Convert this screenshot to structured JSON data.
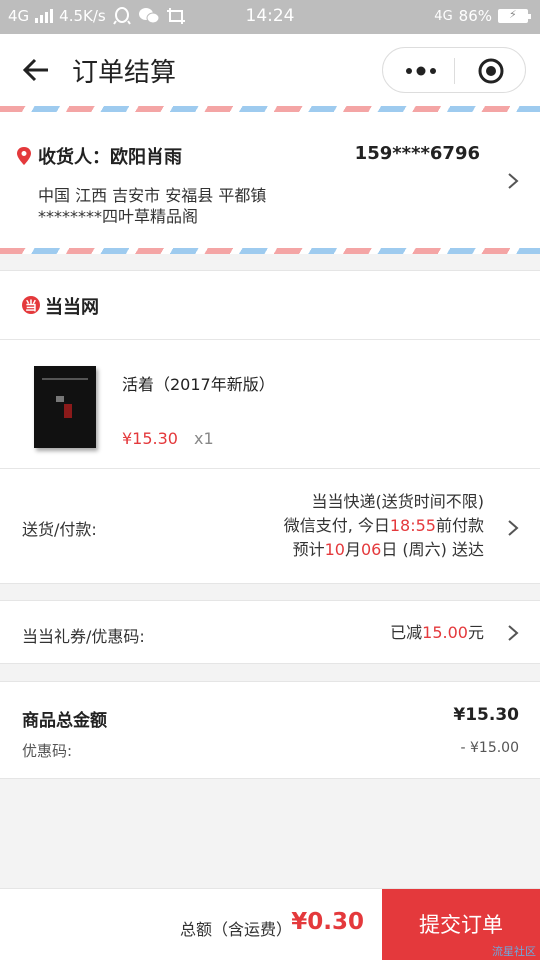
{
  "status_bar": {
    "network_left": "4G",
    "speed": "4.5K/s",
    "time": "14:24",
    "network_right": "4G",
    "battery": "86%"
  },
  "nav": {
    "title": "订单结算",
    "back_icon": "back-arrow-icon",
    "more_icon": "more-dots-icon",
    "close_icon": "target-icon"
  },
  "address": {
    "receiver": "收货人：欧阳肖雨",
    "phone": "159****6796",
    "line1": "中国 江西 吉安市 安福县 平都镇",
    "line2": "********四叶草精品阁"
  },
  "store": {
    "logo_char": "当",
    "name": "当当网"
  },
  "item": {
    "title": "活着（2017年新版）",
    "price": "¥15.30",
    "qty": "x1"
  },
  "shipping": {
    "label": "送货/付款:",
    "line1": "当当快递(送货时间不限)",
    "line2_prefix": "微信支付, 今日",
    "line2_time": "18:55",
    "line2_suffix": "前付款",
    "line3_prefix": "预计",
    "line3_month": "10",
    "line3_mid": "月",
    "line3_day": "06",
    "line3_suffix": "日 (周六) 送达"
  },
  "coupon": {
    "label": "当当礼券/优惠码:",
    "value_prefix": "已减",
    "value_amount": "15.00",
    "value_suffix": "元"
  },
  "summary": {
    "goods_label": "商品总金额",
    "goods_value": "¥15.30",
    "promo_label": "优惠码:",
    "promo_value": "- ¥15.00"
  },
  "footer": {
    "total_label": "总额（含运费）",
    "total_value": "¥0.30",
    "submit_label": "提交订单",
    "watermark": "流星社区"
  },
  "colors": {
    "accent": "#e4393c",
    "status_bar": "#bdbdbd"
  }
}
